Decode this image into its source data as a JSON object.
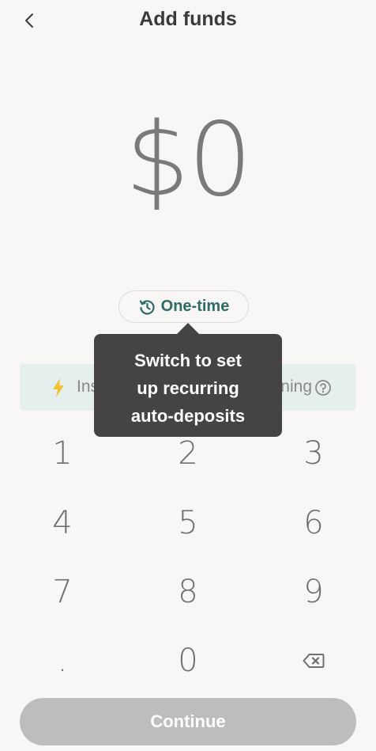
{
  "header": {
    "title": "Add funds",
    "back_icon": "chevron-left-icon"
  },
  "amount": {
    "value": "$0"
  },
  "frequency": {
    "label": "One-time",
    "icon": "history-icon"
  },
  "banner": {
    "icon": "lightning-bolt-icon",
    "left_text": "Ins",
    "right_text": "ning",
    "help_icon": "question-circle-icon"
  },
  "tooltip": {
    "line1": "Switch to set",
    "line2": "up recurring",
    "line3": "auto-deposits"
  },
  "keypad": {
    "keys": [
      "1",
      "2",
      "3",
      "4",
      "5",
      "6",
      "7",
      "8",
      "9",
      ".",
      "0"
    ],
    "backspace_icon": "backspace-icon"
  },
  "continue": {
    "label": "Continue"
  },
  "colors": {
    "background": "#f8f7f5",
    "accent": "#2f6b66",
    "tooltip_bg": "#454443",
    "banner_bg": "#e4efee",
    "button_disabled": "#bdbdbb",
    "bolt": "#f2c230"
  }
}
